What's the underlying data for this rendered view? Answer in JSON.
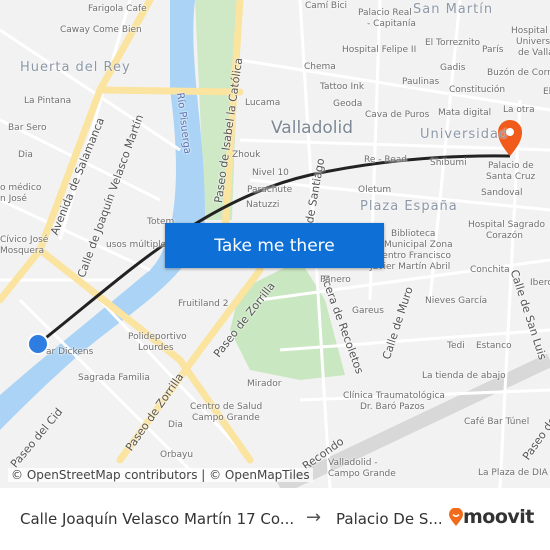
{
  "map": {
    "districts": [
      "Huerta del Rey",
      "San Martín",
      "Universidad",
      "Plaza España"
    ],
    "city": "Valladolid",
    "streets": [
      "Avenida de Salamanca",
      "Calle de Joaquín Velasco Martín",
      "Río Pisuerga",
      "Paseo de Isabel la Católica",
      "Paseo de Zorrilla",
      "Paseo de Zorrilla",
      "Paseo del Cid",
      "Acera de Recoletos",
      "Calle de Muro",
      "Calle de San Luis",
      "de Santiago",
      "Paseo de",
      "Recondo"
    ],
    "pois": [
      "Farigola Cafe",
      "Caway Come Bien",
      "La Pintana",
      "Bar Sero",
      "Dia",
      "o médico",
      "n José",
      "Cívico José",
      "Mosquera",
      "usos múltiples",
      "Totem",
      "Zhouk",
      "Nivel 10",
      "Parachute",
      "Natuzzi",
      "Lucama",
      "Camí Bici",
      "Palacio Real",
      "- Capitanía",
      "Hospital Felipe II",
      "El Torreznito",
      "París",
      "Hospital Clínico",
      "Universitario",
      "de Valladolid",
      "Chema",
      "Gadis",
      "Buzón de Correos",
      "Tattoo Ink",
      "Paulinas",
      "Constitución",
      "Geoda",
      "Cava de Puros",
      "Mata digital",
      "La otra",
      "Re - Read",
      "Shibumi",
      "Palacio de",
      "Santa Cruz",
      "Oletum",
      "Sandoval",
      "Hospital Sagrado",
      "Corazón",
      "Biblioteca",
      "Municipal Zona",
      "Centro Francisco",
      "Javier Martín Abril",
      "Panero",
      "Conchita",
      "Iberc",
      "Nieves García",
      "Gareus",
      "Tedi",
      "Estanco",
      "La tienda de abajo",
      "Clínica Traumatológica",
      "Dr. Baró Pazos",
      "Café Bar Túnel",
      "Valladolid -",
      "Campo Grande",
      "La Plaza de DIA",
      "Fruitiland 2",
      "Polideportivo",
      "Lourdes",
      "ar Dickens",
      "Sagrada Familia",
      "Mirador",
      "Centro de Salud",
      "Campo Grande",
      "Dia",
      "Orbayu",
      "El"
    ],
    "attribution": "© OpenStreetMap contributors | © OpenMapTiles",
    "cta_label": "Take me there",
    "colors": {
      "route": "#222222",
      "origin": "#2f7de1",
      "destination": "#f05a1a",
      "cta": "#0e6fd6",
      "river": "#aad3f5",
      "park": "#c9e7c0",
      "major_road": "#fbe4a0"
    }
  },
  "footer": {
    "from": "Calle Joaquín Velasco Martín 17 Co...",
    "arrow": "→",
    "to": "Palacio De S...",
    "logo": "moovit"
  }
}
